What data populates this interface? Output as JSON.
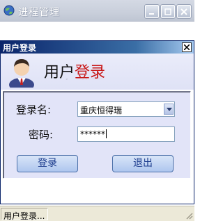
{
  "outer_window": {
    "title": "进程管理"
  },
  "login_dialog": {
    "title": "用户登录",
    "header": {
      "title_part1": "用户",
      "title_part2": "登录",
      "title_part2_color": "#c81818"
    },
    "username": {
      "label": "登录名:",
      "value": "重庆恒得瑞"
    },
    "password": {
      "label": "密码:",
      "masked_value": "******"
    },
    "buttons": {
      "login": "登录",
      "exit": "退出"
    }
  },
  "status_bar": {
    "text": "用户登录..."
  },
  "colors": {
    "dialog_titlebar": "#0a246a",
    "form_background": "#e2e4f8",
    "button_text": "#1a3a8c"
  }
}
